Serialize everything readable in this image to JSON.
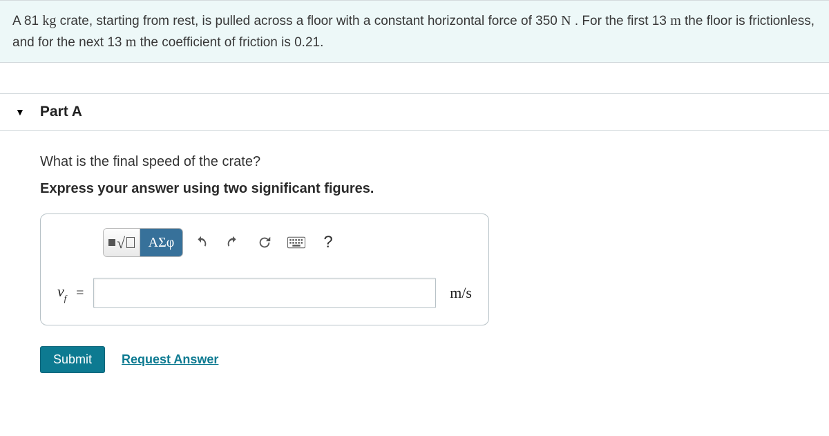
{
  "problem": {
    "text_parts": [
      "A 81 ",
      "kg",
      " crate, starting from rest, is pulled across a floor with a constant horizontal force of 350 ",
      "N",
      " . For the first 13 ",
      "m",
      " the floor is frictionless, and for the next 13 ",
      "m",
      " the coefficient of friction is 0.21."
    ]
  },
  "part": {
    "label": "Part A",
    "question": "What is the final speed of the crate?",
    "instruction": "Express your answer using two significant figures."
  },
  "toolbar": {
    "greek_label": "ΑΣφ",
    "help_label": "?"
  },
  "input": {
    "variable_html": "v",
    "subscript": "f",
    "equals": "=",
    "value": "",
    "unit": "m/s"
  },
  "actions": {
    "submit": "Submit",
    "request": "Request Answer"
  }
}
